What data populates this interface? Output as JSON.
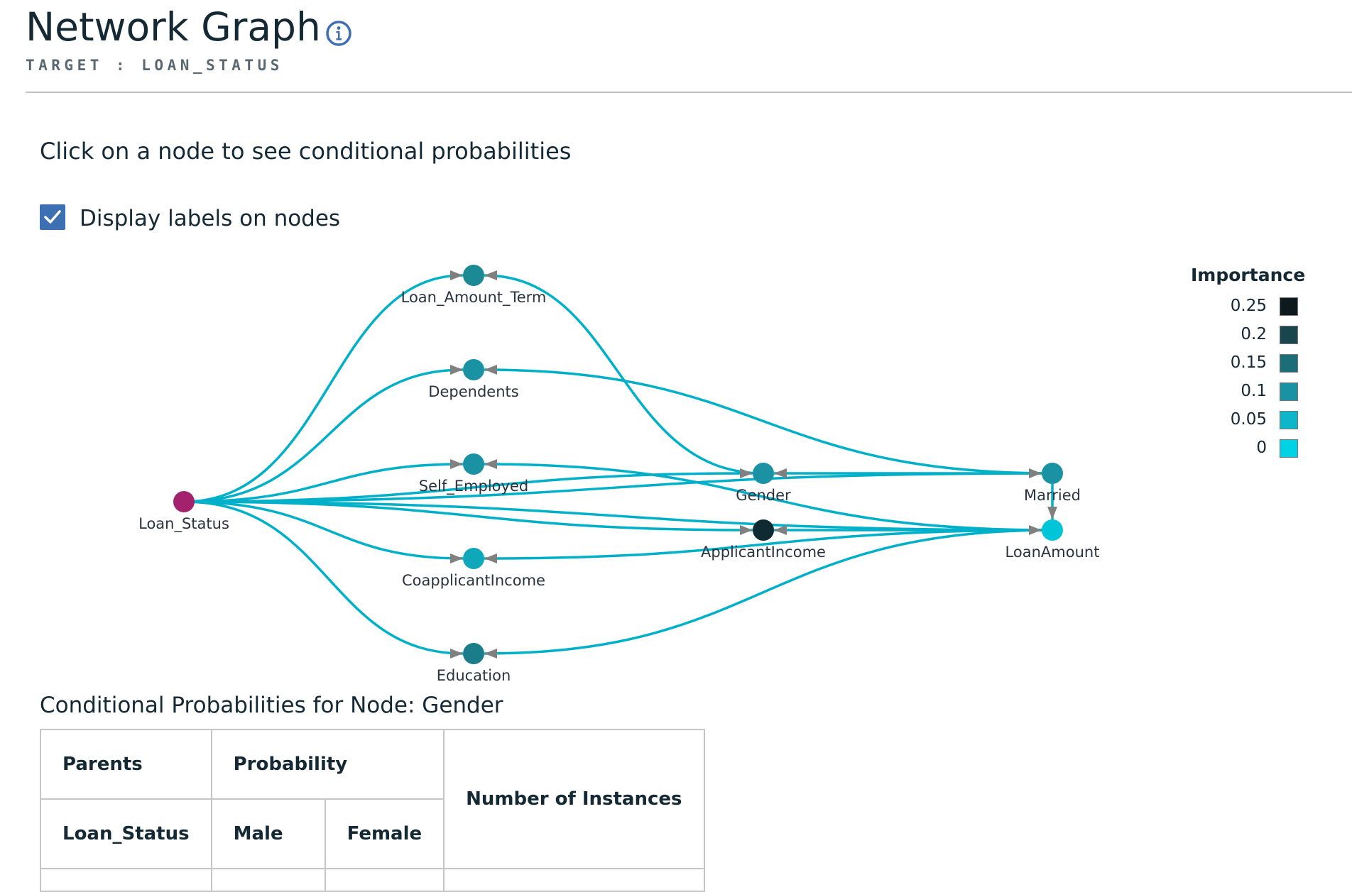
{
  "header": {
    "title": "Network Graph",
    "info_icon": "info-icon",
    "subtitle": "TARGET : LOAN_STATUS"
  },
  "instruction": "Click on a node to see conditional probabilities",
  "display_labels": {
    "label": "Display labels on nodes",
    "checked": true
  },
  "graph": {
    "nodes": [
      {
        "id": "loan_status",
        "label": "Loan_Status",
        "color": "#a3226e"
      },
      {
        "id": "loan_amount_term",
        "label": "Loan_Amount_Term",
        "color": "#1b8a95"
      },
      {
        "id": "dependents",
        "label": "Dependents",
        "color": "#1a92a4"
      },
      {
        "id": "self_employed",
        "label": "Self_Employed",
        "color": "#1a92a4"
      },
      {
        "id": "coapplicant_income",
        "label": "CoapplicantIncome",
        "color": "#0fa8ba"
      },
      {
        "id": "education",
        "label": "Education",
        "color": "#1b7d8a"
      },
      {
        "id": "gender",
        "label": "Gender",
        "color": "#1a92a4"
      },
      {
        "id": "applicant_income",
        "label": "ApplicantIncome",
        "color": "#0f2a33"
      },
      {
        "id": "married",
        "label": "Married",
        "color": "#1a92a4"
      },
      {
        "id": "loan_amount",
        "label": "LoanAmount",
        "color": "#00c5d8"
      }
    ],
    "edges": [
      {
        "from": "loan_status",
        "to": "loan_amount_term"
      },
      {
        "from": "loan_status",
        "to": "dependents"
      },
      {
        "from": "loan_status",
        "to": "self_employed"
      },
      {
        "from": "loan_status",
        "to": "coapplicant_income"
      },
      {
        "from": "loan_status",
        "to": "education"
      },
      {
        "from": "loan_status",
        "to": "gender"
      },
      {
        "from": "loan_status",
        "to": "applicant_income"
      },
      {
        "from": "loan_status",
        "to": "married"
      },
      {
        "from": "loan_status",
        "to": "loan_amount"
      },
      {
        "from": "married",
        "to": "gender"
      },
      {
        "from": "gender",
        "to": "loan_amount_term"
      },
      {
        "from": "married",
        "to": "dependents"
      },
      {
        "from": "loan_amount",
        "to": "self_employed"
      },
      {
        "from": "loan_amount",
        "to": "applicant_income"
      },
      {
        "from": "loan_amount",
        "to": "coapplicant_income"
      },
      {
        "from": "loan_amount",
        "to": "education"
      },
      {
        "from": "married",
        "to": "loan_amount"
      }
    ],
    "edge_color": "#00b0c8",
    "arrow_color": "#808080"
  },
  "legend": {
    "title": "Importance",
    "items": [
      {
        "label": "0.25",
        "color": "#0c1a1d"
      },
      {
        "label": "0.2",
        "color": "#18454e"
      },
      {
        "label": "0.15",
        "color": "#1b6e78"
      },
      {
        "label": "0.1",
        "color": "#1a92a4"
      },
      {
        "label": "0.05",
        "color": "#0fb6c9"
      },
      {
        "label": "0",
        "color": "#00d2e6"
      }
    ]
  },
  "conditional_probabilities": {
    "title": "Conditional Probabilities for Node: Gender",
    "headers": {
      "parents": "Parents",
      "probability": "Probability",
      "instances": "Number of Instances",
      "parent_name": "Loan_Status",
      "value_1": "Male",
      "value_2": "Female"
    }
  }
}
